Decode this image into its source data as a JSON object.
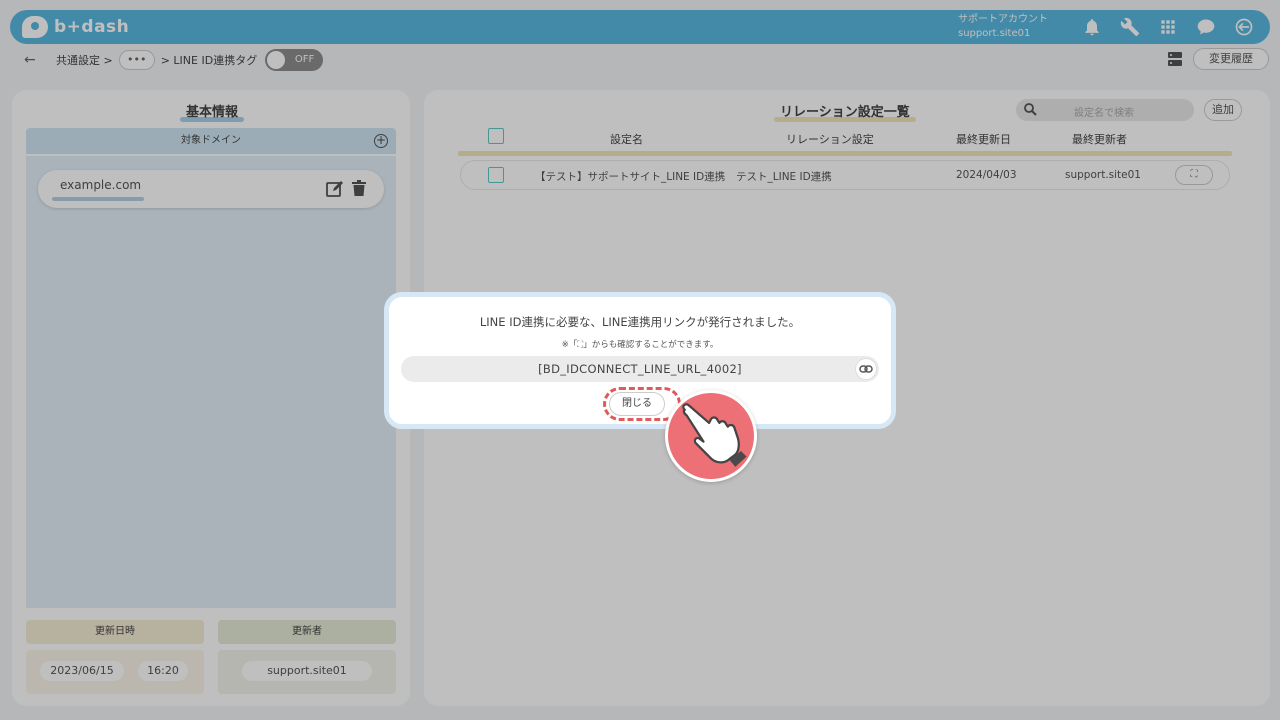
{
  "header": {
    "logo_text": "b+dash",
    "account_label": "サポートアカウント",
    "account_id": "support.site01",
    "icons": [
      "bell-icon",
      "wrench-icon",
      "apps-grid-icon",
      "chat-bubble-icon",
      "logout-icon"
    ]
  },
  "subbar": {
    "back_icon": "←",
    "crumb_1": "共通設定 >",
    "ellipsis": "•••",
    "crumb_2": "> LINE ID連携タグ",
    "toggle_label": "OFF",
    "history_button": "変更履歴"
  },
  "left_panel": {
    "title": "基本情報",
    "domain_header": "対象ドメイン",
    "add_icon": "+",
    "domains": [
      {
        "value": "example.com"
      }
    ],
    "updated_at_label": "更新日時",
    "updated_date": "2023/06/15",
    "updated_time": "16:20",
    "updated_by_label": "更新者",
    "updated_by": "support.site01"
  },
  "right_panel": {
    "title": "リレーション設定一覧",
    "search_placeholder": "設定名で検索",
    "add_button": "追加",
    "columns": {
      "name": "設定名",
      "relation": "リレーション設定",
      "updated": "最終更新日",
      "updater": "最終更新者"
    },
    "rows": [
      {
        "name": "【テスト】サポートサイト_LINE ID連携",
        "relation": "テスト_LINE ID連携",
        "updated": "2024/04/03",
        "updater": "support.site01",
        "action": "⛶"
      }
    ]
  },
  "modal": {
    "message": "LINE ID連携に必要な、LINE連携用リンクが発行されました。",
    "note": "※「⛶」からも確認することができます。",
    "url": "[BD_IDCONNECT_LINE_URL_4002]",
    "close_button": "閉じる"
  },
  "colors": {
    "header_blue": "#5ab8e0",
    "accent_red": "#ec7075",
    "checkbox_teal": "#5fc8c8",
    "title_underline_blue": "#a9d2ea",
    "title_underline_yellow": "#f2e6b8"
  }
}
